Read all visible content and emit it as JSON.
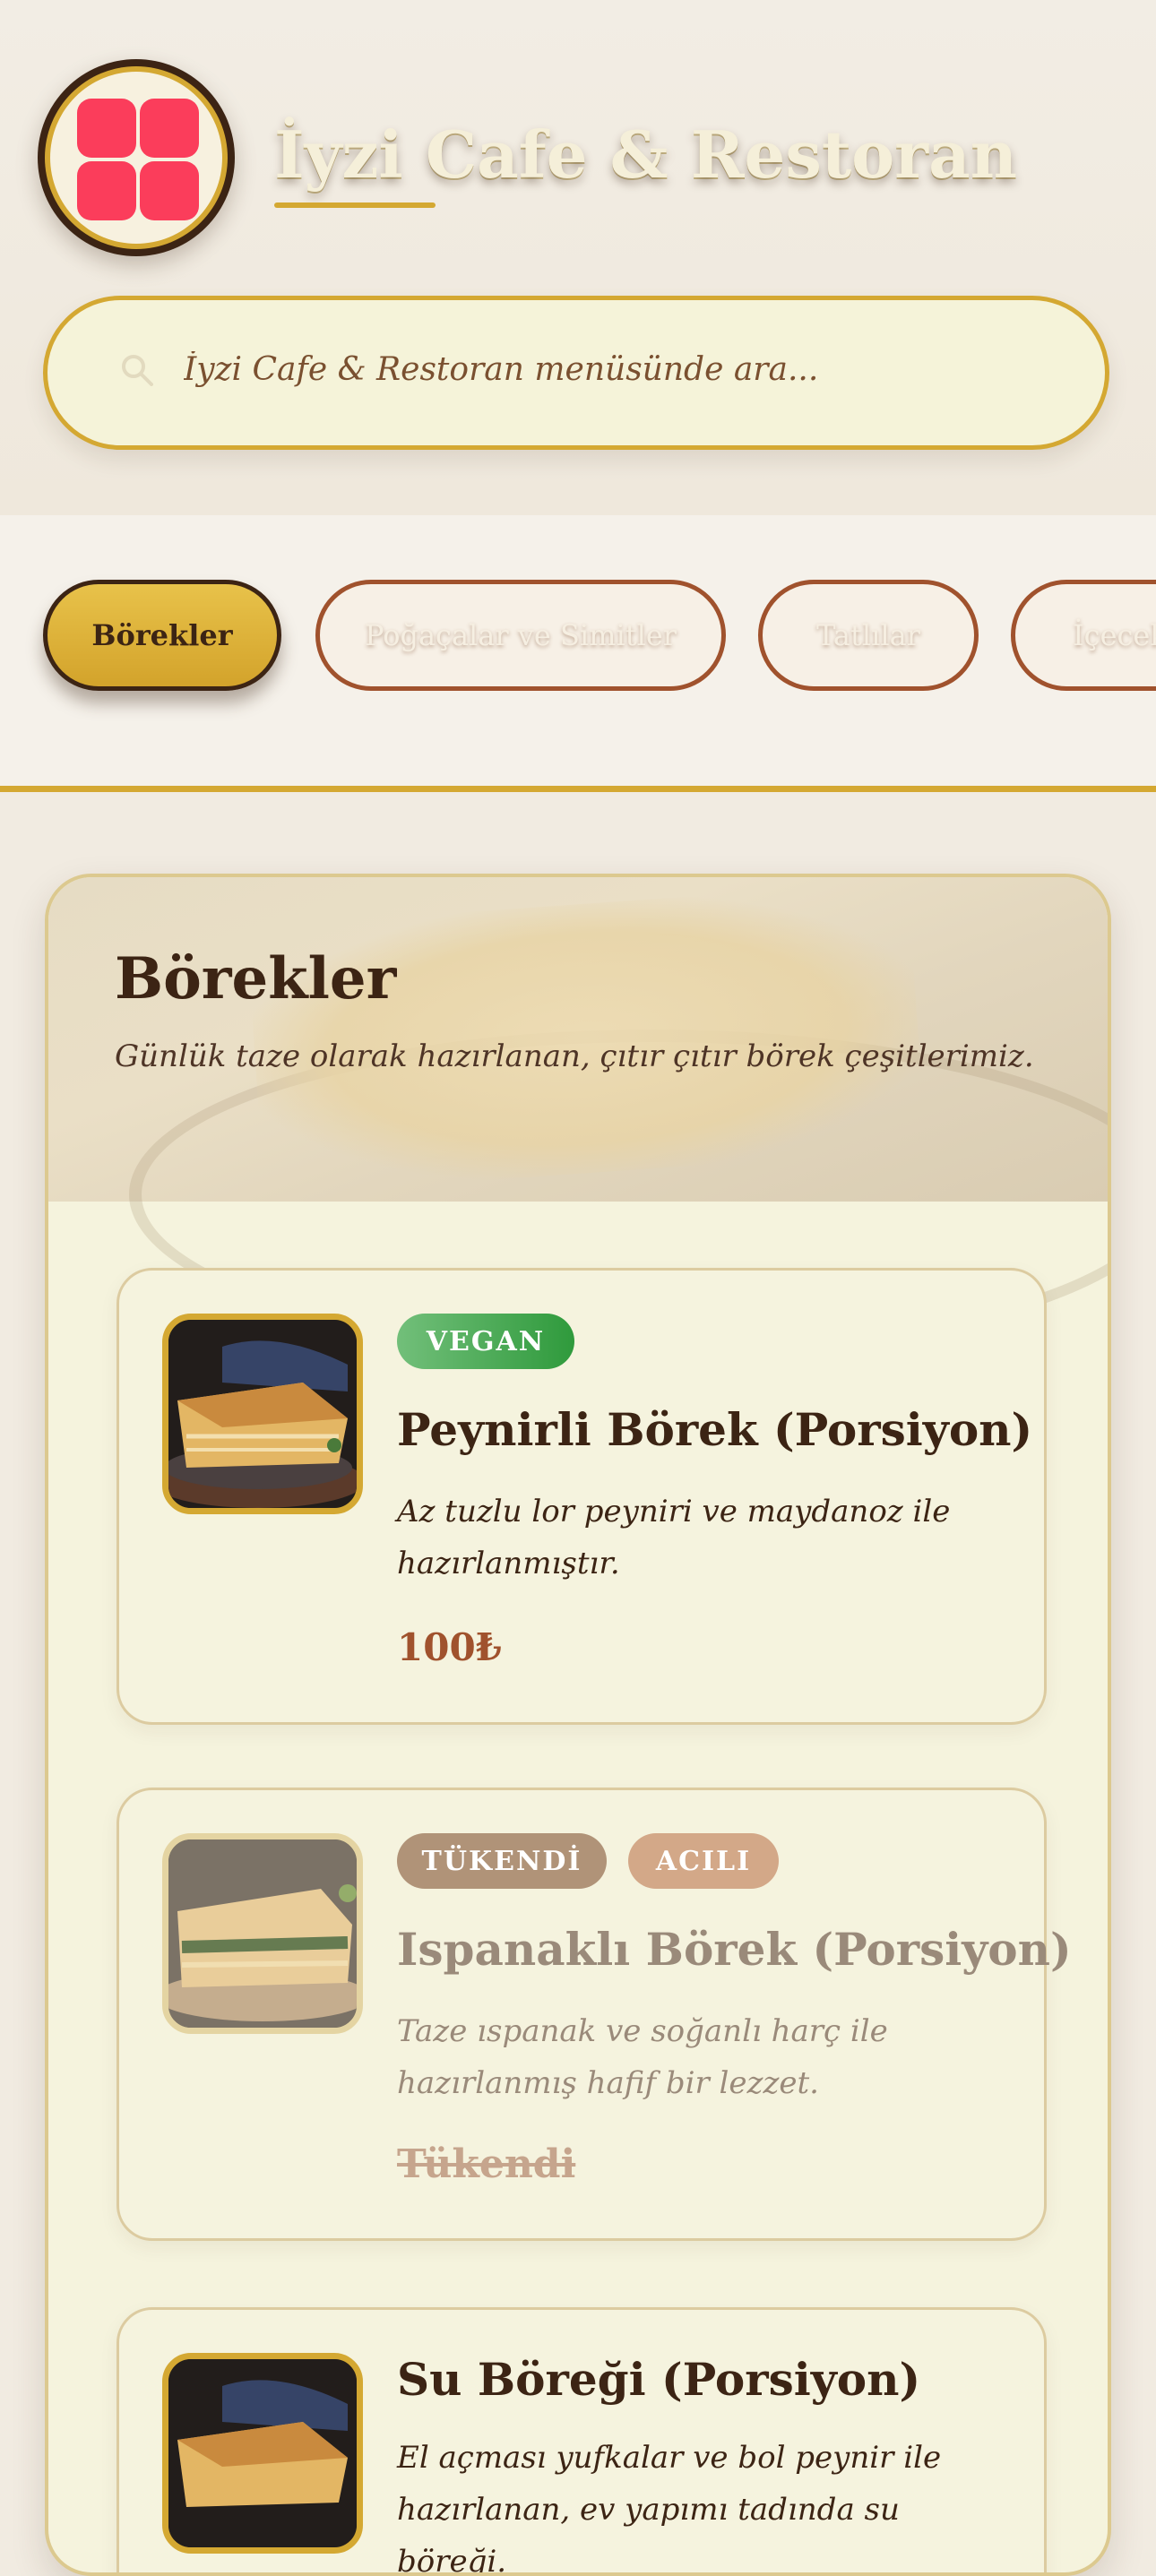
{
  "header": {
    "brand": "İyzi Cafe & Restoran",
    "logo_icon": "app-grid-icon",
    "search_placeholder": "İyzi Cafe & Restoran menüsünde ara..."
  },
  "tabs": [
    {
      "label": "Börekler",
      "active": true
    },
    {
      "label": "Poğaçalar ve Simitler",
      "active": false
    },
    {
      "label": "Tatlılar",
      "active": false
    },
    {
      "label": "İçecek",
      "active": false
    }
  ],
  "section": {
    "title": "Börekler",
    "description": "Günlük taze olarak hazırlanan, çıtır çıtır börek çeşitlerimiz."
  },
  "items": [
    {
      "badges": [
        "VEGAN"
      ],
      "name": "Peynirli Börek (Porsiyon)",
      "description": "Az tuzlu lor peyniri ve maydanoz ile hazırlanmıştır.",
      "price": "100₺",
      "sold_out": false
    },
    {
      "badges": [
        "TÜKENDİ",
        "ACILI"
      ],
      "name": "Ispanaklı Börek (Porsiyon)",
      "description": "Taze ıspanak ve soğanlı harç ile hazırlanmış hafif bir lezzet.",
      "status": "Tükendi",
      "sold_out": true
    },
    {
      "badges": [],
      "name": "Su Böreği (Porsiyon)",
      "description": "El açması yufkalar ve bol peynir ile hazırlanan, ev yapımı tadında su böreği.",
      "sold_out": false
    }
  ],
  "colors": {
    "accent_gold": "#d4a832",
    "brown": "#3c2414",
    "price": "#a0522d",
    "vegan": "#3a9a44",
    "soldout_badge": "#b09378",
    "spicy_badge": "#d3a888"
  }
}
